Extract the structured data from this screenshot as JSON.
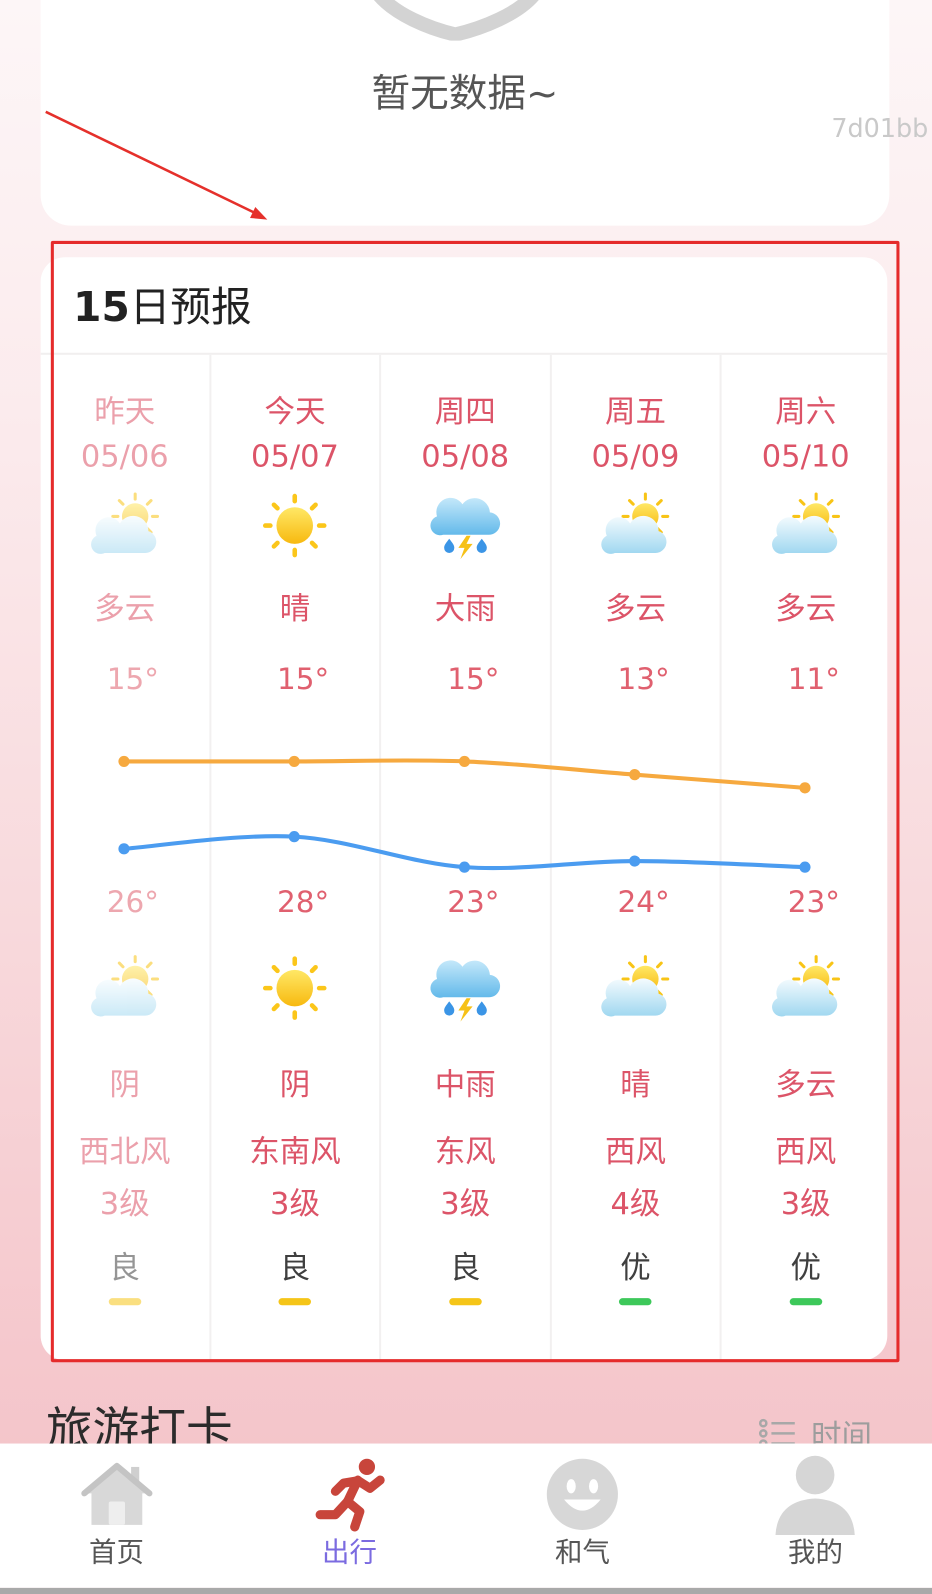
{
  "top_card": {
    "shield_icon": "shield-icon",
    "empty_text": "暂无数据~",
    "code_text": "7d01bb"
  },
  "annotation": {
    "color": "#e5302b"
  },
  "forecast": {
    "title_num": "15",
    "title_rest": "日预报",
    "days": [
      {
        "day": "昨天",
        "date": "05/06",
        "day_icon": "partly-cloudy-icon",
        "day_weather": "多云",
        "top_temp": "15°",
        "bottom_temp": "26°",
        "night_icon": "partly-cloudy-icon",
        "night_weather": "阴",
        "wind_dir": "西北风",
        "wind_level": "3级",
        "aqi": "良",
        "aqi_color": "#f5c518",
        "faded": true
      },
      {
        "day": "今天",
        "date": "05/07",
        "day_icon": "sun-icon",
        "day_weather": "晴",
        "top_temp": "15°",
        "bottom_temp": "28°",
        "night_icon": "sun-icon",
        "night_weather": "阴",
        "wind_dir": "东南风",
        "wind_level": "3级",
        "aqi": "良",
        "aqi_color": "#f5c518"
      },
      {
        "day": "周四",
        "date": "05/08",
        "day_icon": "thunderstorm-icon",
        "day_weather": "大雨",
        "top_temp": "15°",
        "bottom_temp": "23°",
        "night_icon": "thunderstorm-icon",
        "night_weather": "中雨",
        "wind_dir": "东风",
        "wind_level": "3级",
        "aqi": "良",
        "aqi_color": "#f5c518"
      },
      {
        "day": "周五",
        "date": "05/09",
        "day_icon": "partly-cloudy-icon",
        "day_weather": "多云",
        "top_temp": "13°",
        "bottom_temp": "24°",
        "night_icon": "partly-cloudy-icon",
        "night_weather": "晴",
        "wind_dir": "西风",
        "wind_level": "4级",
        "aqi": "优",
        "aqi_color": "#3dc85a"
      },
      {
        "day": "周六",
        "date": "05/10",
        "day_icon": "partly-cloudy-icon",
        "day_weather": "多云",
        "top_temp": "11°",
        "bottom_temp": "23°",
        "night_icon": "partly-cloudy-icon",
        "night_weather": "多云",
        "wind_dir": "西风",
        "wind_level": "3级",
        "aqi": "优",
        "aqi_color": "#3dc85a"
      }
    ]
  },
  "chart_data": {
    "type": "line",
    "categories": [
      "05/06",
      "05/07",
      "05/08",
      "05/09",
      "05/10"
    ],
    "series": [
      {
        "values": [
          15,
          15,
          15,
          13,
          11
        ],
        "color": "#f6a93f"
      },
      {
        "values": [
          26,
          28,
          23,
          24,
          23
        ],
        "color": "#4b9cf0"
      }
    ],
    "grid": false
  },
  "travel": {
    "title": "旅游打卡",
    "sort_icon": "list-icon",
    "sort_label": "时间"
  },
  "nav": {
    "active_color": "#7b6be0",
    "items": [
      {
        "label": "首页",
        "icon": "home-icon"
      },
      {
        "label": "出行",
        "icon": "running-icon",
        "active": true
      },
      {
        "label": "和气",
        "icon": "smiley-icon"
      },
      {
        "label": "我的",
        "icon": "person-icon"
      }
    ]
  }
}
